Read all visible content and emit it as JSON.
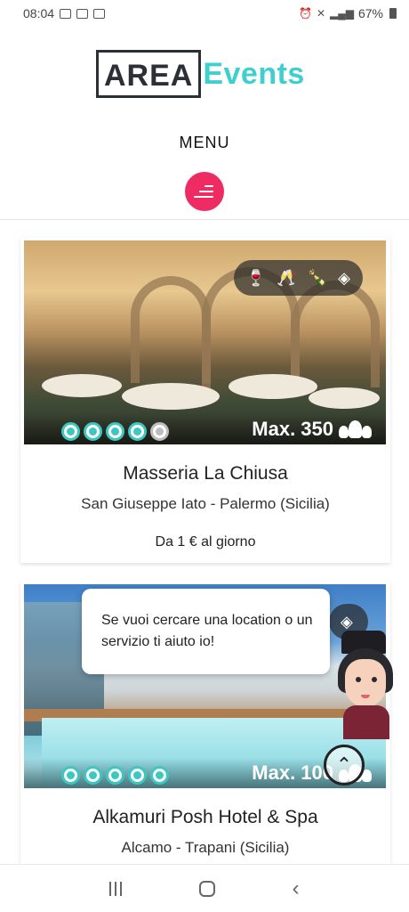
{
  "status_bar": {
    "time": "08:04",
    "battery": "67%"
  },
  "brand": {
    "logo_area": "AREA",
    "logo_events": "Events"
  },
  "menu": {
    "label": "MENU"
  },
  "listings": [
    {
      "name": "Masseria La Chiusa",
      "location": "San Giuseppe Iato - Palermo (Sicilia)",
      "price": "Da 1 € al giorno",
      "capacity": "Max. 350",
      "rating": 4,
      "rating_max": 5,
      "amenities": [
        "wine-glass-icon",
        "champagne-glasses-icon",
        "wine-bottles-icon",
        "diamond-icon"
      ]
    },
    {
      "name": "Alkamuri Posh Hotel & Spa",
      "location": "Alcamo - Trapani (Sicilia)",
      "capacity": "Max. 100",
      "rating": 5,
      "rating_max": 5,
      "amenities": [
        "diamond-icon"
      ]
    }
  ],
  "chat": {
    "message": "Se vuoi cercare una location o un servizio ti aiuto io!"
  },
  "colors": {
    "accent_teal": "#3fcfcf",
    "menu_pink": "#ef2b63",
    "rating_teal": "#3ec7c2"
  }
}
